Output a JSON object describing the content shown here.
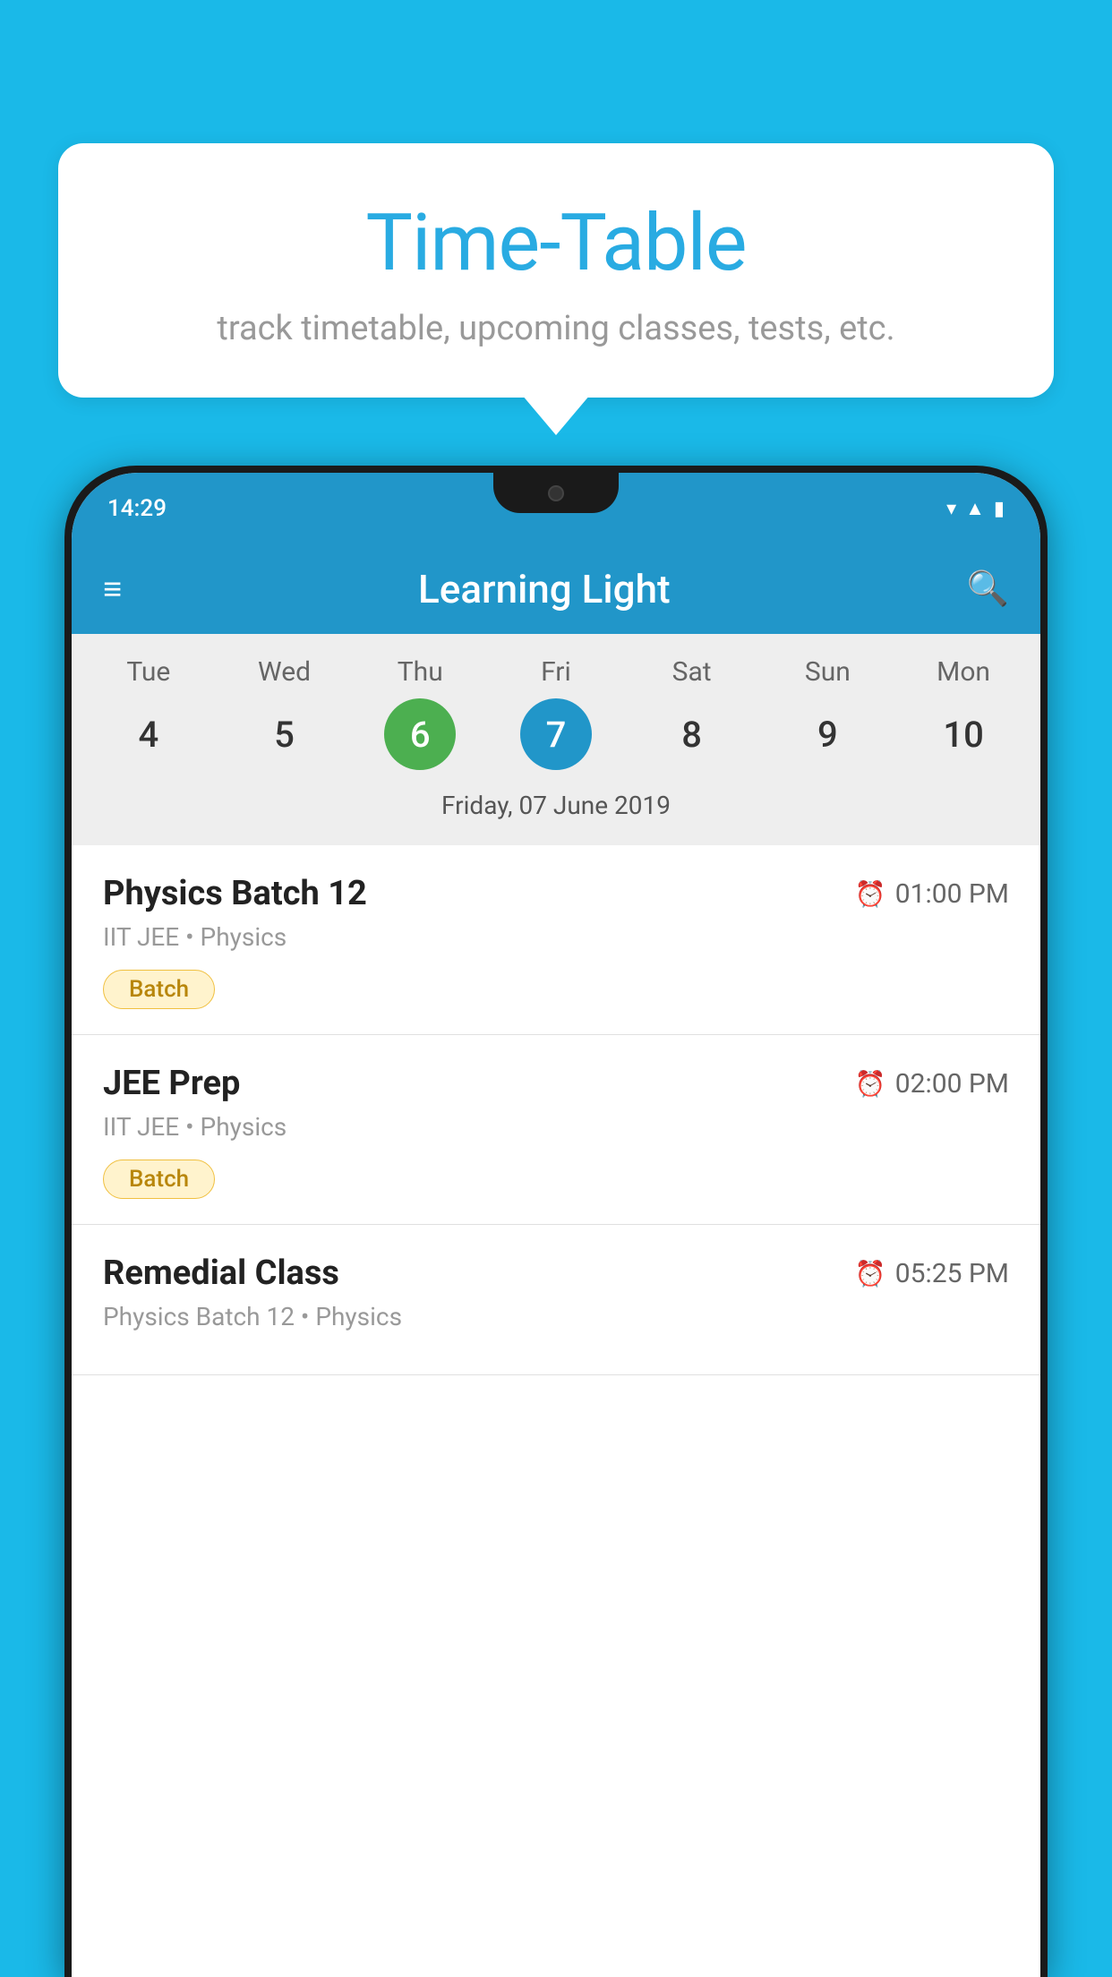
{
  "background": {
    "color": "#1ab9e8"
  },
  "speech_bubble": {
    "title": "Time-Table",
    "subtitle": "track timetable, upcoming classes, tests, etc."
  },
  "phone": {
    "status_bar": {
      "time": "14:29",
      "icons": [
        "wifi",
        "signal",
        "battery"
      ]
    },
    "app_bar": {
      "title": "Learning Light",
      "menu_icon": "≡",
      "search_icon": "🔍"
    },
    "calendar": {
      "days": [
        {
          "name": "Tue",
          "num": "4",
          "state": "normal"
        },
        {
          "name": "Wed",
          "num": "5",
          "state": "normal"
        },
        {
          "name": "Thu",
          "num": "6",
          "state": "today"
        },
        {
          "name": "Fri",
          "num": "7",
          "state": "selected"
        },
        {
          "name": "Sat",
          "num": "8",
          "state": "normal"
        },
        {
          "name": "Sun",
          "num": "9",
          "state": "normal"
        },
        {
          "name": "Mon",
          "num": "10",
          "state": "normal"
        }
      ],
      "selected_date_label": "Friday, 07 June 2019"
    },
    "schedule": [
      {
        "title": "Physics Batch 12",
        "time": "01:00 PM",
        "subtitle": "IIT JEE • Physics",
        "badge": "Batch"
      },
      {
        "title": "JEE Prep",
        "time": "02:00 PM",
        "subtitle": "IIT JEE • Physics",
        "badge": "Batch"
      },
      {
        "title": "Remedial Class",
        "time": "05:25 PM",
        "subtitle": "Physics Batch 12 • Physics",
        "badge": null
      }
    ]
  }
}
